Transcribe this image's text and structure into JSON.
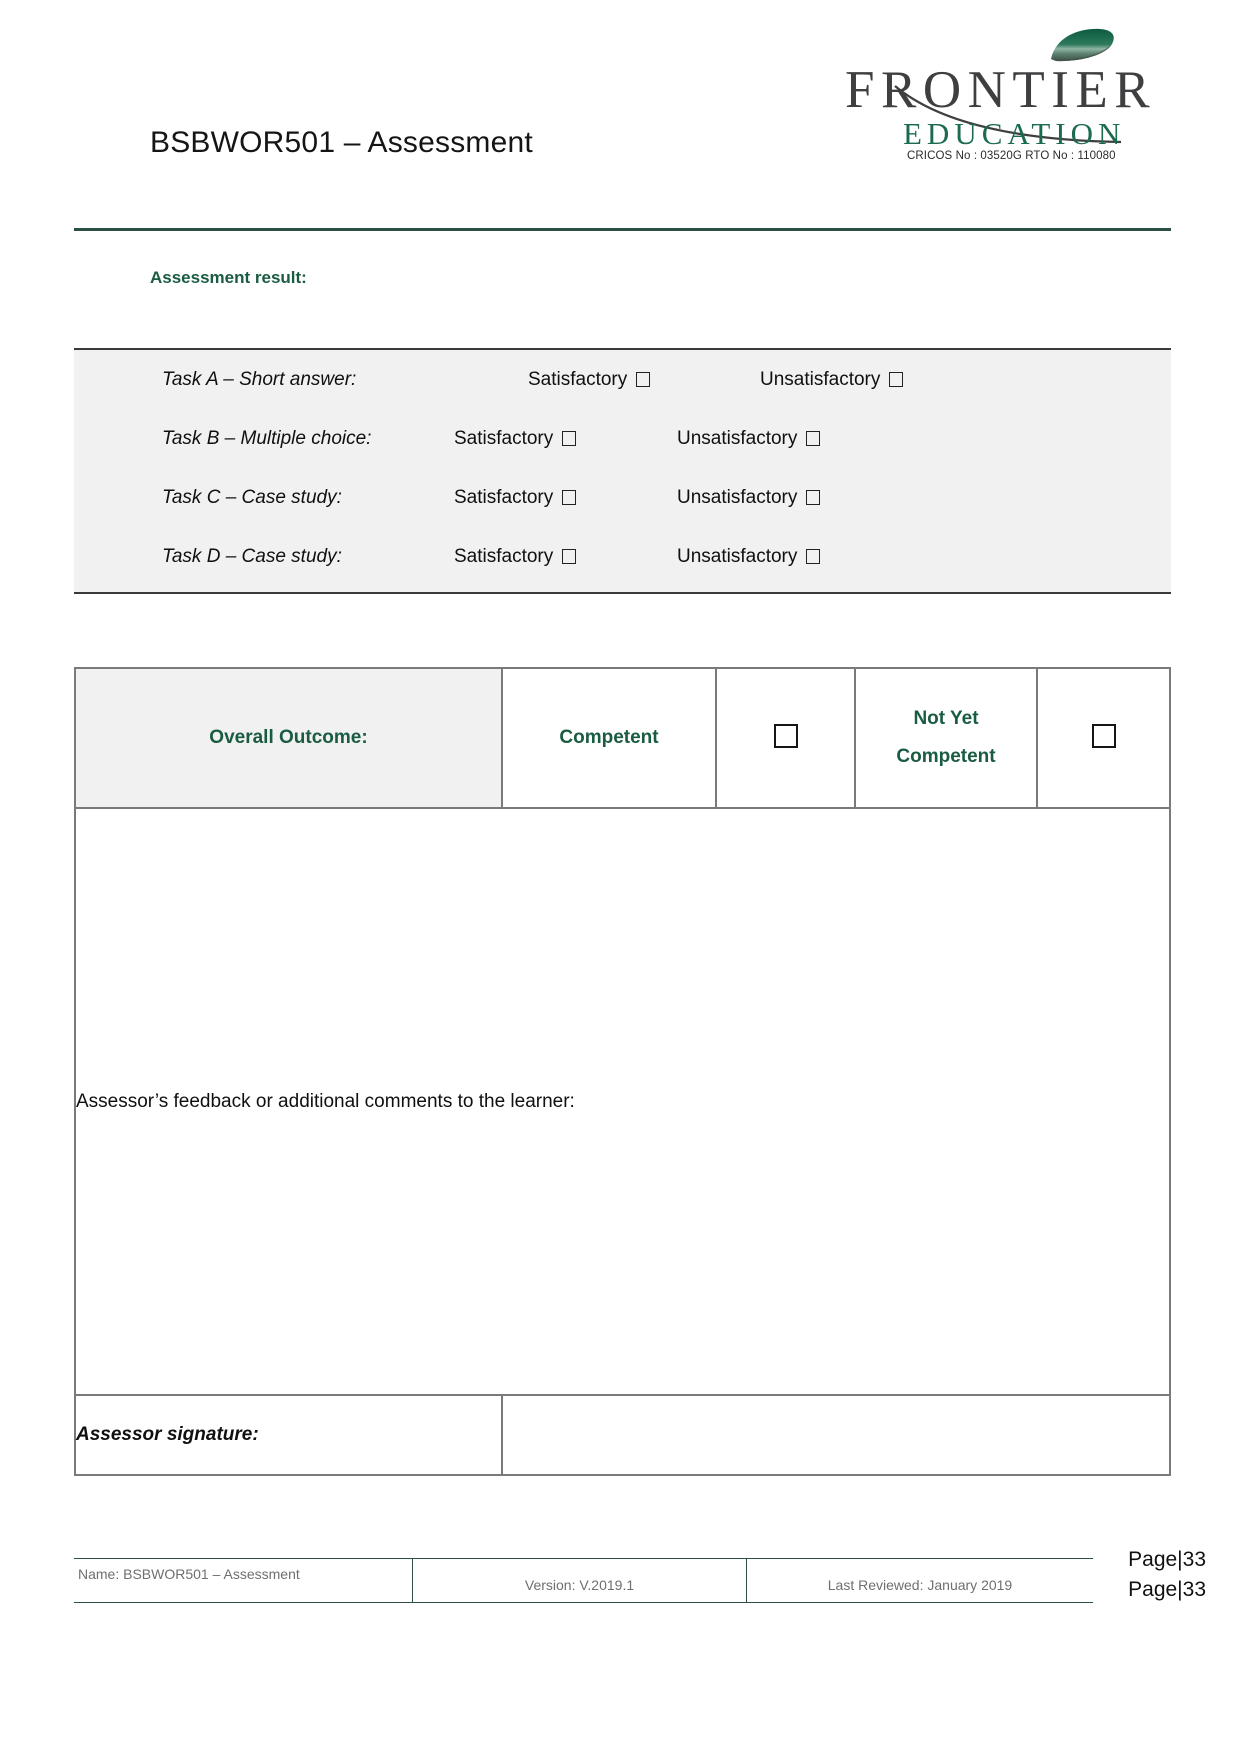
{
  "header": {
    "doc_title": "BSBWOR501 – Assessment",
    "logo": {
      "wordmark_primary": "FRONTIER",
      "wordmark_secondary": "EDUCATION",
      "codes": "CRICOS No : 03520G    RTO No : 110080",
      "leaf_color": "#1d6b4f",
      "primary_color": "#3f3f41",
      "secondary_color": "#1b6b4e"
    },
    "rule_color": "#2c4f43"
  },
  "assessment_result": {
    "heading": "Assessment result:",
    "heading_color": "#1a5c42",
    "satisfactory_label": "Satisfactory",
    "unsatisfactory_label": "Unsatisfactory",
    "tasks": [
      {
        "label": "Task A – Short answer:",
        "satisfactory": "Satisfactory",
        "unsatisfactory": "Unsatisfactory",
        "satisfactory_checked": false,
        "unsatisfactory_checked": false
      },
      {
        "label": "Task B – Multiple choice:",
        "satisfactory": "Satisfactory",
        "unsatisfactory": "Unsatisfactory",
        "satisfactory_checked": false,
        "unsatisfactory_checked": false
      },
      {
        "label": "Task C – Case study:",
        "satisfactory": "Satisfactory",
        "unsatisfactory": "Unsatisfactory",
        "satisfactory_checked": false,
        "unsatisfactory_checked": false
      },
      {
        "label": "Task D – Case study:",
        "satisfactory": "Satisfactory",
        "unsatisfactory": "Unsatisfactory",
        "satisfactory_checked": false,
        "unsatisfactory_checked": false
      }
    ]
  },
  "outcome": {
    "label": "Overall Outcome:",
    "competent_label": "Competent",
    "not_yet_competent_line1": "Not Yet",
    "not_yet_competent_line2": "Competent",
    "competent_checked": false,
    "not_yet_competent_checked": false,
    "feedback_prompt": "Assessor’s feedback or additional comments to the learner:",
    "feedback_value": "",
    "signature_label": "Assessor signature:",
    "signature_value": "",
    "accent_color": "#1a5c42",
    "border_color": "#7a7a7a",
    "label_cell_background": "#f1f1f1"
  },
  "footer": {
    "name": "Name:          BSBWOR501        –  Assessment",
    "version": "Version: V.2019.1",
    "last_reviewed": "Last Reviewed: January 2019",
    "page_line_1": "Page|33",
    "page_line_2": "Page|33",
    "rule_color": "#2c4f43"
  }
}
